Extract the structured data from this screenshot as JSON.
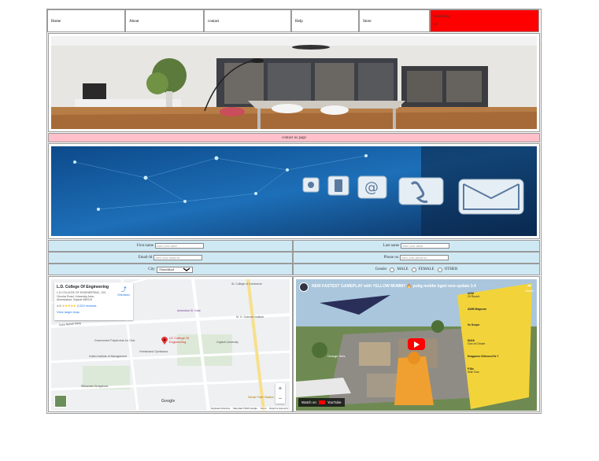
{
  "nav": {
    "items": [
      "Home",
      "About",
      "contact",
      "Help",
      "Store"
    ],
    "sub_items": [
      "Store Item",
      "LS"
    ]
  },
  "banner": {
    "label": "contact us page"
  },
  "form": {
    "first_name": {
      "label": "First name",
      "placeholder": "enter your name"
    },
    "last_name": {
      "label": "Last name",
      "placeholder": "enter your name"
    },
    "email": {
      "label": "Email-Id",
      "placeholder": "enter your email-id"
    },
    "phone": {
      "label": "Phone no",
      "placeholder": "enter your phone no"
    },
    "city": {
      "label": "City",
      "value": "Ahmedabad"
    },
    "gender": {
      "label": "Gender",
      "options": [
        "MALE",
        "FEMALE",
        "OTHER"
      ]
    }
  },
  "map": {
    "place_title": "L.D. College Of Engineering",
    "address": "L.D.COLLEGE OF ENGINEERING, 120, Circular Road, University Area, Ahmedabad, Gujarat 380015",
    "rating": "4.5",
    "reviews": "2,024 reviews",
    "directions": "Directions",
    "view_larger": "View larger map",
    "marker_label": "LD College Of Engineering",
    "labels": [
      "St. College of Commerce",
      "Ambedkar St. Gate",
      "M. G. Science Institute",
      "Government Polytechnic for Girls",
      "Vivekanand Gymkhana",
      "Gujarat University",
      "Indian Institute of Management",
      "Rikhavdev Bungalows",
      "Sardar Patel Stadium",
      "Guru Nanak Marg",
      "Google"
    ],
    "zoom_in": "+",
    "zoom_out": "−",
    "footer": [
      "Keyboard shortcuts",
      "Map data ©2023 Google",
      "Terms",
      "Report a map error"
    ]
  },
  "video": {
    "title": "NEW FASTEST GAMEPLAY with YELLOW MUMMY 🔥 pubg mobile bgmi new update 3.4",
    "watch_on": "Watch on",
    "youtube": "YouTube",
    "share": "Share",
    "overlay_text": "Orange Sets",
    "items": [
      {
        "name": "AKM",
        "sub": "20 Round"
      },
      {
        "name": "AWM Magnum",
        "sub": ""
      },
      {
        "name": "9x Scope",
        "sub": ""
      },
      {
        "name": "M416",
        "sub": "Gun of Choice"
      },
      {
        "name": "Dragunov Silenced 5x 7",
        "sub": ""
      },
      {
        "name": "P18c",
        "sub": "Side Gun"
      }
    ]
  },
  "colors": {
    "nav_red": "#ff0000",
    "banner_pink": "#ffc0cb",
    "form_blue": "#cfe9f4"
  }
}
